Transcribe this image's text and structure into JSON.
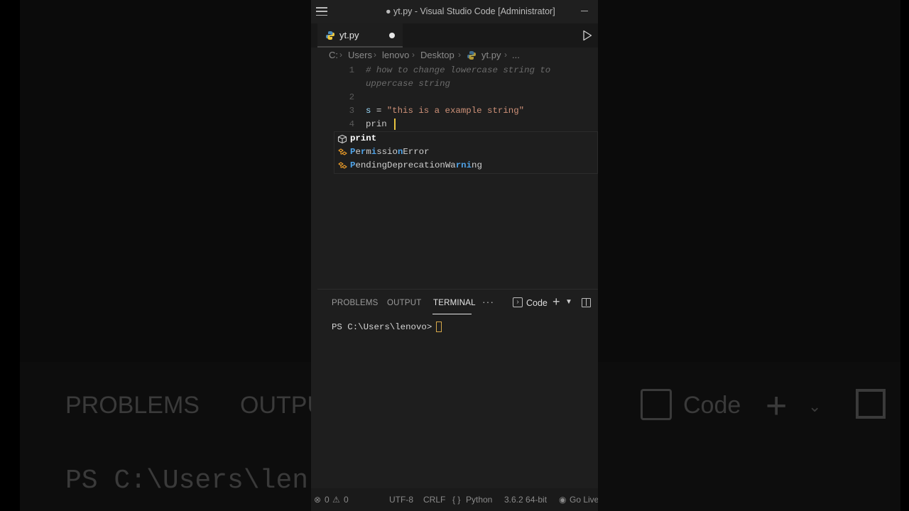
{
  "window": {
    "title": "● yt.py - Visual Studio Code [Administrator]"
  },
  "tab": {
    "label": "yt.py",
    "icon": "python-icon"
  },
  "breadcrumb": {
    "items": [
      "C:",
      "Users",
      "lenovo",
      "Desktop",
      "yt.py",
      "..."
    ]
  },
  "editor": {
    "lines": [
      {
        "number": "1",
        "comment_a": "# how to change lowercase string to",
        "comment_b": "uppercase string"
      },
      {
        "number": "2"
      },
      {
        "number": "3",
        "var": "s",
        "op": " = ",
        "str": "\"this is a example string\""
      },
      {
        "number": "4",
        "text": "prin"
      }
    ]
  },
  "suggestions": [
    {
      "label": "print",
      "icon": "cube-icon"
    },
    {
      "label": "PermissionError",
      "icon": "class-icon"
    },
    {
      "label": "PendingDeprecationWarning",
      "icon": "class-icon"
    }
  ],
  "panel": {
    "tabs": [
      "PROBLEMS",
      "OUTPUT",
      "TERMINAL"
    ],
    "more": "···",
    "terminal_name": "Code",
    "prompt": "PS C:\\Users\\lenovo>"
  },
  "statusbar": {
    "errors": "0",
    "warnings": "0",
    "encoding": "UTF-8",
    "eol": "CRLF",
    "language": "Python",
    "interpreter": "3.6.2 64-bit",
    "live": "Go Live"
  },
  "background": {
    "problems": "PROBLEMS",
    "output": "OUTPU",
    "code": "Code",
    "prompt": "PS C:\\Users\\len"
  },
  "colors": {
    "editor_bg": "#1e1e1e",
    "string": "#ce9178",
    "variable": "#9cdcfe",
    "cursor": "#e8c440",
    "match": "#4fa3e8"
  }
}
